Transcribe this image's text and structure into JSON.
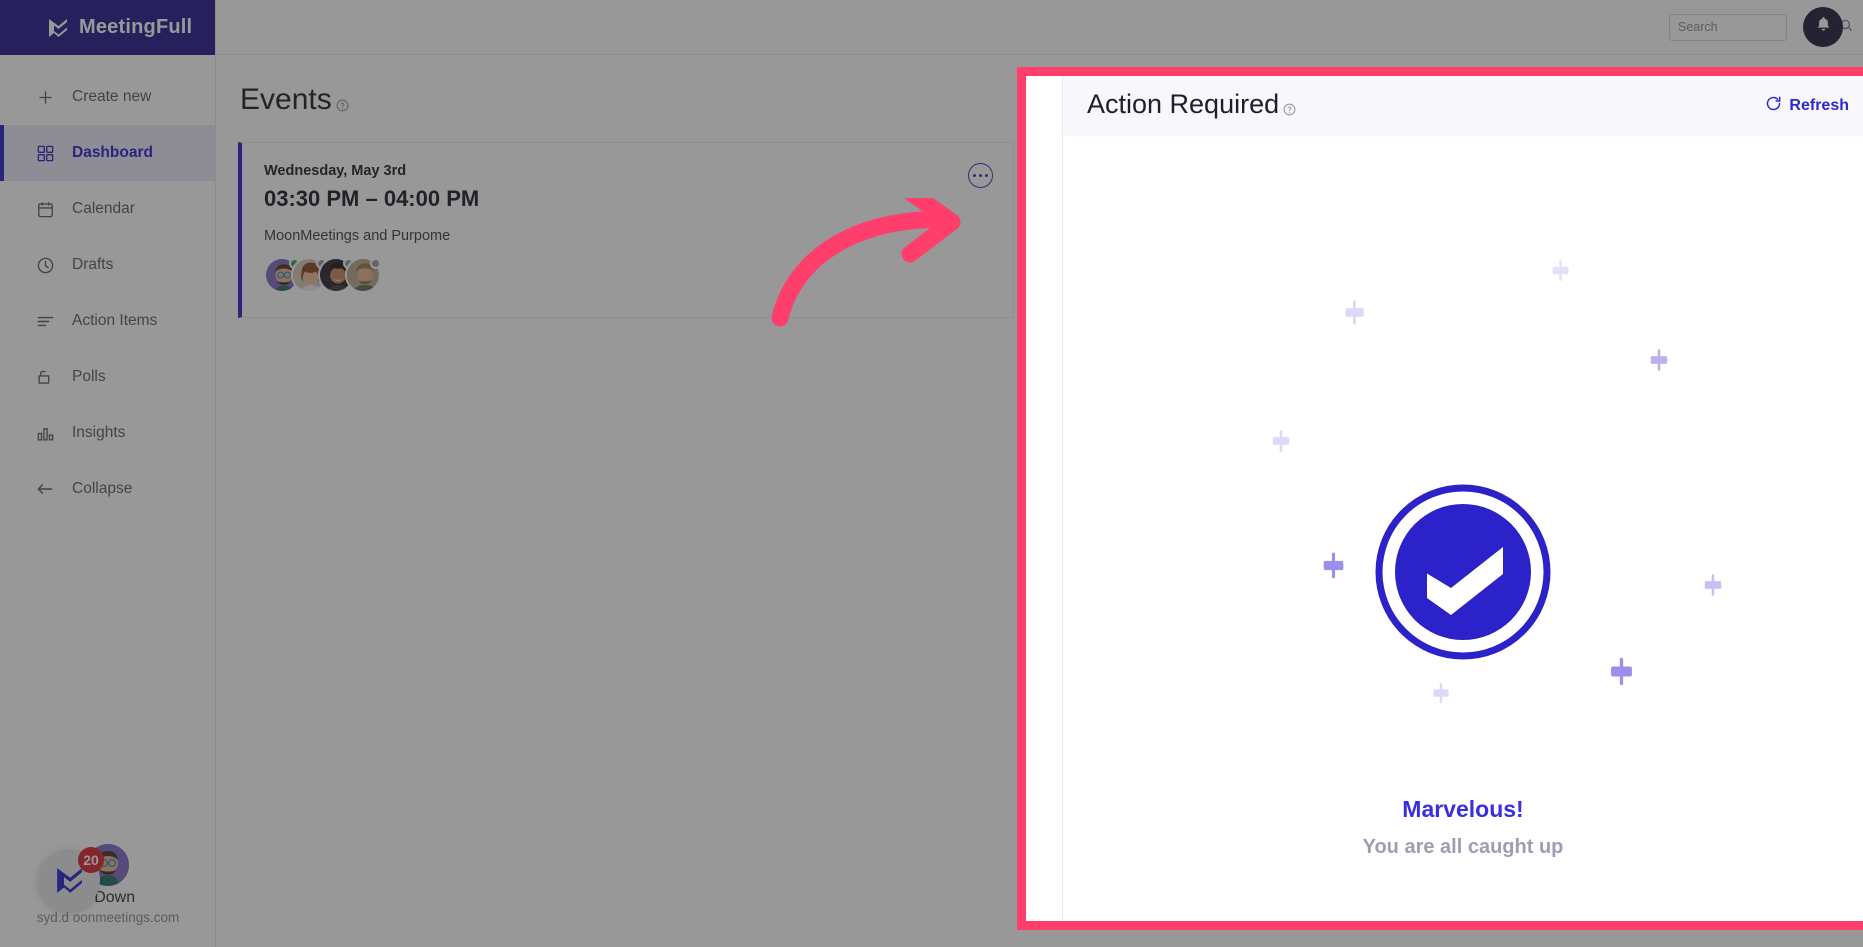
{
  "brand": {
    "name": "MeetingFull",
    "logo_icon": "meetingfull-logo-icon",
    "bg_color": "#251a8f"
  },
  "topbar": {
    "search": {
      "placeholder": "Search",
      "value": "",
      "icon": "search-icon"
    },
    "bell_icon": "notification-bell-icon"
  },
  "sidebar": {
    "items": [
      {
        "label": "Create new",
        "icon": "plus-icon",
        "active": false
      },
      {
        "label": "Dashboard",
        "icon": "grid-icon",
        "active": true
      },
      {
        "label": "Calendar",
        "icon": "calendar-icon",
        "active": false
      },
      {
        "label": "Drafts",
        "icon": "clock-icon",
        "active": false
      },
      {
        "label": "Action Items",
        "icon": "list-lines-icon",
        "active": false
      },
      {
        "label": "Polls",
        "icon": "poll-icon",
        "active": false
      },
      {
        "label": "Insights",
        "icon": "bar-chart-icon",
        "active": false
      },
      {
        "label": "Collapse",
        "icon": "arrow-left-icon",
        "active": false
      }
    ],
    "profile": {
      "name": "d Down",
      "email": "syd.d        oonmeetings.com",
      "avatar_icon": "user-avatar"
    },
    "fab": {
      "icon": "meetingfull-logo-icon",
      "badge_count": "20",
      "badge_color": "#d8252f"
    }
  },
  "main": {
    "page_title": "Events",
    "help_icon": "help-circle-icon",
    "event": {
      "date": "Wednesday, May 3rd",
      "time": "03:30 PM – 04:00 PM",
      "subtitle": "MoonMeetings and Purpome",
      "menu_icon": "kebab-menu-icon",
      "accent_color": "#2b22c9",
      "attendees": [
        {
          "name": "attendee-1",
          "status": "online",
          "status_color": "#21b14b"
        },
        {
          "name": "attendee-2",
          "status": "offline",
          "status_color": "#9a9aa8"
        },
        {
          "name": "attendee-3",
          "status": "offline",
          "status_color": "#9a9aa8"
        },
        {
          "name": "attendee-4",
          "status": "offline",
          "status_color": "#9a9aa8"
        }
      ]
    }
  },
  "panel": {
    "title": "Action Required",
    "help_icon": "help-circle-icon",
    "refresh_label": "Refresh",
    "refresh_icon": "refresh-icon",
    "empty_state": {
      "badge_icon": "meetingfull-check-badge-icon",
      "title": "Marvelous!",
      "subtitle": "You are all caught up"
    },
    "highlight_color": "#ff3e6c"
  },
  "annotation": {
    "arrow_icon": "curved-arrow-right-icon",
    "color": "#ff3e6c"
  }
}
